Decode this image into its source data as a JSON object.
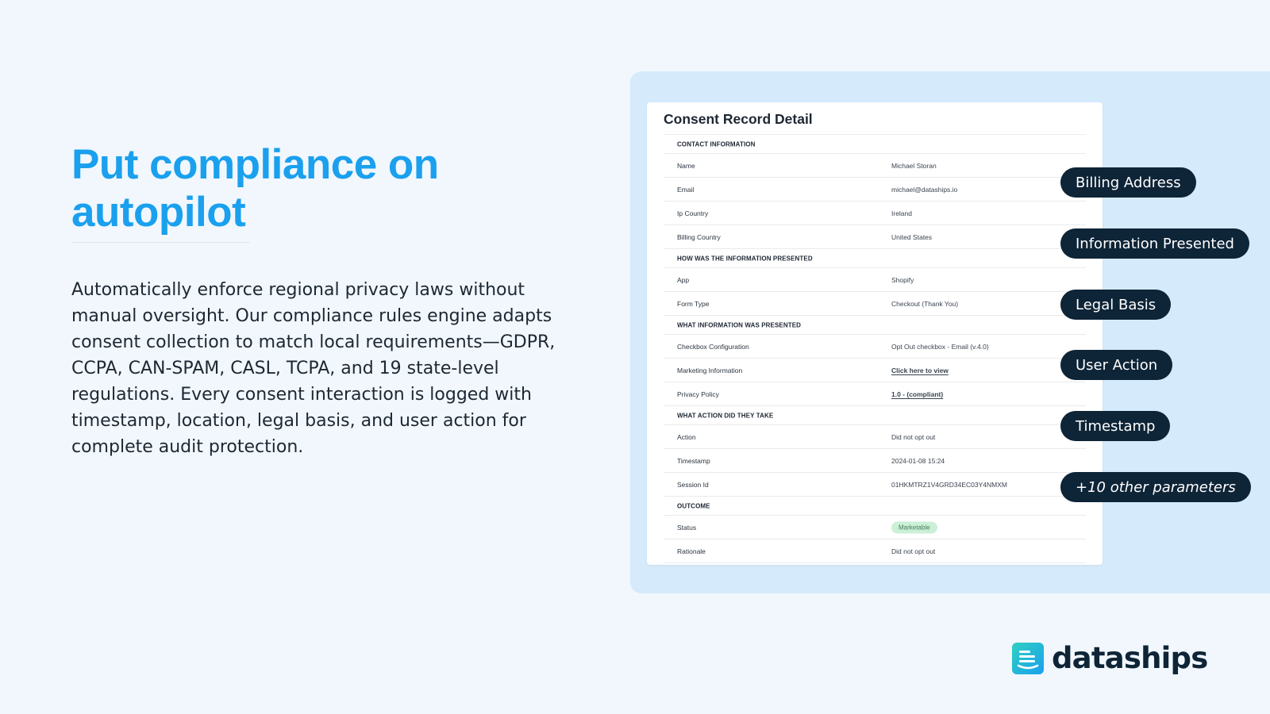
{
  "hero": {
    "headline_line1": "Put compliance on",
    "headline_line2": "autopilot",
    "body": "Automatically enforce regional privacy laws without manual oversight. Our compliance rules engine adapts consent collection to match local requirements—GDPR, CCPA, CAN-SPAM, CASL, TCPA, and 19 state-level regulations. Every consent interaction is logged with timestamp, location, legal basis, and user action for complete audit protection."
  },
  "card": {
    "title": "Consent Record Detail",
    "rows": [
      {
        "type": "section",
        "label": "CONTACT INFORMATION"
      },
      {
        "type": "field",
        "label": "Name",
        "value": "Michael Storan"
      },
      {
        "type": "field",
        "label": "Email",
        "value": "michael@dataships.io"
      },
      {
        "type": "field",
        "label": "Ip Country",
        "value": "Ireland"
      },
      {
        "type": "field",
        "label": "Billing Country",
        "value": "United States"
      },
      {
        "type": "section",
        "label": "HOW WAS THE INFORMATION PRESENTED"
      },
      {
        "type": "field",
        "label": "App",
        "value": "Shopify"
      },
      {
        "type": "field",
        "label": "Form Type",
        "value": "Checkout (Thank You)"
      },
      {
        "type": "section",
        "label": "WHAT INFORMATION WAS PRESENTED"
      },
      {
        "type": "field",
        "label": "Checkbox Configuration",
        "value": "Opt Out checkbox - Email (v.4.0)"
      },
      {
        "type": "link",
        "label": "Marketing Information",
        "value": "Click here to view"
      },
      {
        "type": "link",
        "label": "Privacy Policy",
        "value": "1.0 - (compliant)"
      },
      {
        "type": "section",
        "label": "WHAT ACTION DID THEY TAKE"
      },
      {
        "type": "field",
        "label": "Action",
        "value": "Did not opt out"
      },
      {
        "type": "field",
        "label": "Timestamp",
        "value": "2024-01-08 15:24"
      },
      {
        "type": "field",
        "label": "Session Id",
        "value": "01HKMTRZ1V4GRD34EC03Y4NMXM"
      },
      {
        "type": "section",
        "label": "OUTCOME"
      },
      {
        "type": "badge",
        "label": "Status",
        "value": "Marketable"
      },
      {
        "type": "field",
        "label": "Rationale",
        "value": "Did not opt out"
      }
    ]
  },
  "pills": [
    {
      "label": "Billing Address",
      "italic": false
    },
    {
      "label": "Information Presented",
      "italic": false
    },
    {
      "label": "Legal Basis",
      "italic": false
    },
    {
      "label": "User Action",
      "italic": false
    },
    {
      "label": "Timestamp",
      "italic": false
    },
    {
      "label": "+10 other parameters",
      "italic": true
    }
  ],
  "brand": {
    "name": "dataships",
    "logo_icon": "dataships-logo-icon",
    "colors": {
      "accent": "#1aa0ee",
      "dark": "#0e2437",
      "panel": "#d5eafb",
      "badge_bg": "#ccefd8",
      "badge_text": "#3f7f57",
      "logo_gradient_start": "#2fd0c0",
      "logo_gradient_end": "#1aa0ee"
    }
  }
}
